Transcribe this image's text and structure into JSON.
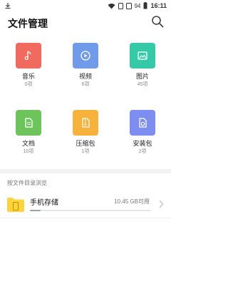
{
  "status_bar": {
    "battery": "94",
    "time": "16:11"
  },
  "header": {
    "title": "文件管理"
  },
  "categories": [
    {
      "label": "音乐",
      "count": "0项",
      "color": "#f06a5e",
      "icon": "music-note-icon"
    },
    {
      "label": "视频",
      "count": "6项",
      "color": "#6f9be8",
      "icon": "play-icon"
    },
    {
      "label": "图片",
      "count": "45项",
      "color": "#35c9a8",
      "icon": "image-icon"
    },
    {
      "label": "文档",
      "count": "10项",
      "color": "#6cc45a",
      "icon": "document-icon"
    },
    {
      "label": "压缩包",
      "count": "1项",
      "color": "#f7b23b",
      "icon": "archive-icon"
    },
    {
      "label": "安装包",
      "count": "2项",
      "color": "#7e8ef0",
      "icon": "package-icon"
    }
  ],
  "browse_section": {
    "title": "按文件目录浏览"
  },
  "storage": {
    "name": "手机存储",
    "free": "10.45 GB可用",
    "used_fraction": 0.09,
    "folder_color": "#ffd43a"
  }
}
